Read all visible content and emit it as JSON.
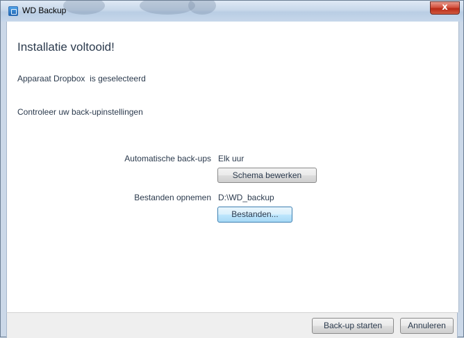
{
  "window": {
    "title": "WD Backup",
    "close_label": "x"
  },
  "main": {
    "heading": "Installatie voltooid!",
    "device_selected": "Apparaat Dropbox  is geselecteerd",
    "check_settings": "Controleer uw back-upinstellingen",
    "settings": {
      "auto_backup_label": "Automatische back-ups",
      "auto_backup_value": "Elk uur",
      "edit_schedule_button": "Schema bewerken",
      "include_files_label": "Bestanden opnemen",
      "include_files_value": "D:\\WD_backup",
      "files_button": "Bestanden..."
    }
  },
  "footer": {
    "start_backup_button": "Back-up starten",
    "cancel_button": "Annuleren"
  },
  "colors": {
    "text": "#2b3a4d",
    "accent_border": "#3c7fb1",
    "close_red": "#c63b28"
  }
}
